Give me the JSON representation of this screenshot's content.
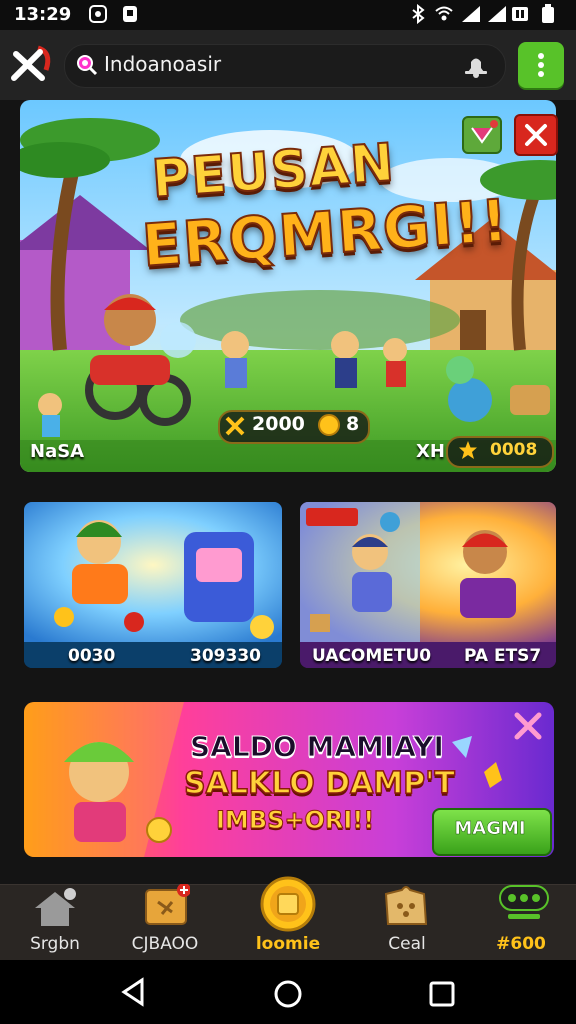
{
  "status": {
    "time": "13:29"
  },
  "search": {
    "text": "Indoanoasir"
  },
  "hero": {
    "title_line1": "PEUSAN",
    "title_line2": "ERQMRGI!!",
    "coins_left": "2000",
    "coins_right": "8",
    "corner_label": "NaSA",
    "stat_prefix": "XH",
    "stat_value": "0008"
  },
  "cards": [
    {
      "left_label": "0030",
      "right_label": "309330"
    },
    {
      "left_label": "UACOMETU0",
      "right_label": "PA ETS7"
    }
  ],
  "promo": {
    "line1": "SALDO MAMIAYI",
    "line2": "SALKLO DAMP'T",
    "line3": "IMBS+ORI!!",
    "button": "MAGMI"
  },
  "bottom_nav": [
    {
      "label": "Srgbn",
      "icon": "home-icon"
    },
    {
      "label": "CJBAOO",
      "icon": "ticket-icon"
    },
    {
      "label": "loomie",
      "icon": "coin-icon"
    },
    {
      "label": "Ceal",
      "icon": "puzzle-icon"
    },
    {
      "label": "#600",
      "icon": "controller-icon"
    }
  ],
  "colors": {
    "accent_green": "#58c229",
    "gold": "#ffc21a",
    "close_red": "#d8271e"
  }
}
